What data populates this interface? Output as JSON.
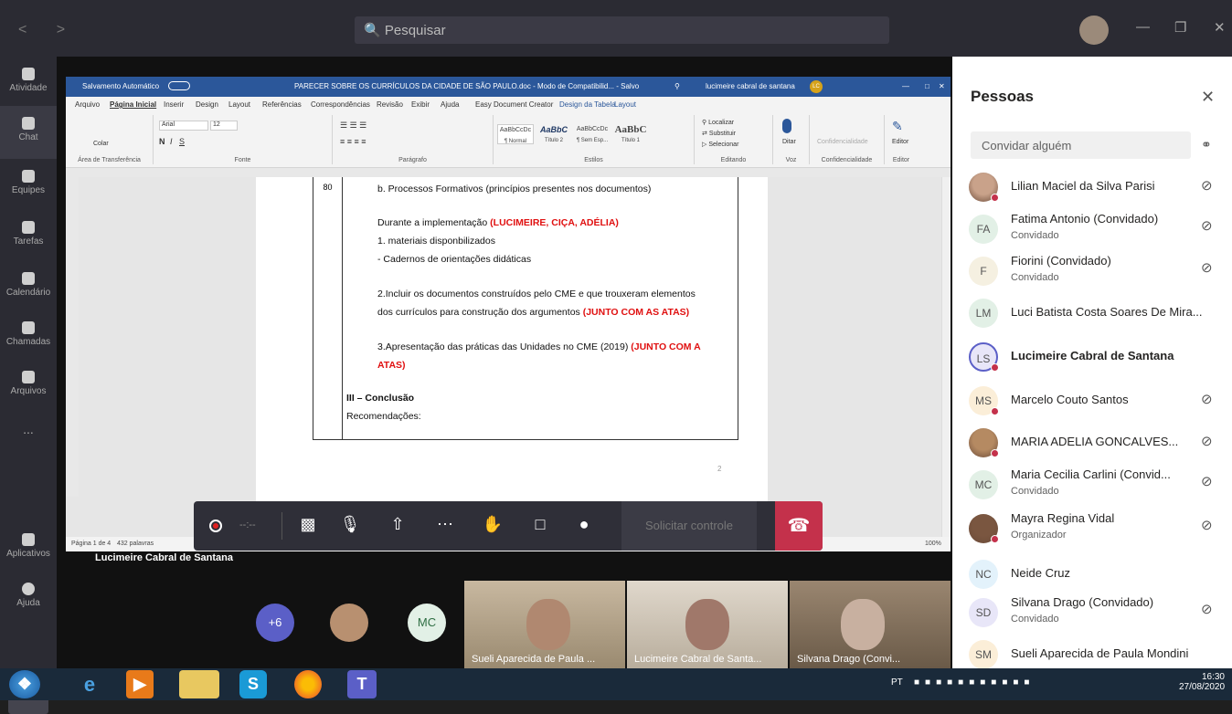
{
  "topbar": {
    "search_placeholder": "Pesquisar"
  },
  "rail": [
    {
      "label": "Atividade",
      "name": "rail-atividade"
    },
    {
      "label": "Chat",
      "name": "rail-chat"
    },
    {
      "label": "Equipes",
      "name": "rail-equipes"
    },
    {
      "label": "Tarefas",
      "name": "rail-tarefas"
    },
    {
      "label": "Calendário",
      "name": "rail-calendario"
    },
    {
      "label": "Chamadas",
      "name": "rail-chamadas"
    },
    {
      "label": "Arquivos",
      "name": "rail-arquivos"
    },
    {
      "label": "...",
      "name": "rail-more"
    },
    {
      "label": "Aplicativos",
      "name": "rail-aplicativos"
    },
    {
      "label": "Ajuda",
      "name": "rail-ajuda"
    }
  ],
  "word": {
    "autosave": "Salvamento Automático",
    "title": "PARECER SOBRE OS CURRÍCULOS DA CIDADE DE SÃO PAULO.doc - Modo de Compatibilid... - Salvo",
    "user": "lucimeire cabral de santana",
    "user_initials": "LC",
    "menu": [
      "Arquivo",
      "Página Inicial",
      "Inserir",
      "Design",
      "Layout",
      "Referências",
      "Correspondências",
      "Revisão",
      "Exibir",
      "Ajuda",
      "Easy Document Creator",
      "Design da Tabela",
      "Layout"
    ],
    "ribbon": {
      "colar": "Colar",
      "clipboard": "Área de Transferência",
      "font_name": "Arial",
      "font_size": "12",
      "fonte": "Fonte",
      "paragrafo": "Parágrafo",
      "styles": [
        {
          "preview": "AaBbCcDc",
          "name": "¶ Normal"
        },
        {
          "preview": "AaBbC",
          "name": "Título 2"
        },
        {
          "preview": "AaBbCcDc",
          "name": "¶ Sem Esp..."
        },
        {
          "preview": "AaBbC",
          "name": "Título 1"
        }
      ],
      "estilos": "Estilos",
      "localizar": "Localizar",
      "substituir": "Substituir",
      "selecionar": "Selecionar",
      "editando": "Editando",
      "ditar": "Ditar",
      "voz": "Voz",
      "confid": "Confidencialidade",
      "editor": "Editor"
    },
    "doc": {
      "row_num": "80",
      "b_line": "b.  Processos Formativos (princípios presentes nos documentos)",
      "impl": "Durante a implementação ",
      "impl_names": "(LUCIMEIRE, CIÇA, ADÉLIA)",
      "item1": "1. materiais disponbilizados",
      "item1b": "- Cadernos de orientações didáticas",
      "item2": "2.Incluir os documentos construídos pelo CME e que trouxeram elementos",
      "item2b": "dos currículos para construção dos argumentos ",
      "item2_red": "(JUNTO COM AS ATAS)",
      "item3": "3.Apresentação das práticas das Unidades no CME (2019) ",
      "item3_red": "(JUNTO COM A",
      "item3_red2": "ATAS)",
      "conclusao": "III – Conclusão",
      "recomend": "Recomendações:",
      "page_num": "2"
    },
    "status": {
      "page": "Página 1 de 4",
      "words": "432 palavras",
      "zoom": "100%"
    }
  },
  "call": {
    "timer": "--:--",
    "request_control": "Solicitar controle",
    "presenter": "Lucimeire Cabral de Santana",
    "overflow": "+6",
    "mc": "MC",
    "tiles": [
      {
        "name": "Sueli Aparecida de Paula ..."
      },
      {
        "name": "Lucimeire Cabral de Santa..."
      },
      {
        "name": "Silvana Drago (Convi..."
      }
    ]
  },
  "people": {
    "title": "Pessoas",
    "invite_placeholder": "Convidar alguém",
    "list": [
      {
        "name": "Lilian Maciel da Silva Parisi",
        "sub": "",
        "initials": "",
        "photo": true,
        "color": "#c9a28a",
        "muted": true,
        "dot": true
      },
      {
        "name": "Fatima Antonio (Convidado)",
        "sub": "Convidado",
        "initials": "FA",
        "photo": false,
        "color": "#e2f0e6",
        "muted": true,
        "dot": false
      },
      {
        "name": "Fiorini (Convidado)",
        "sub": "Convidado",
        "initials": "F",
        "photo": false,
        "color": "#f5f0e1",
        "muted": true,
        "dot": false
      },
      {
        "name": "Luci Batista Costa Soares De Mira...",
        "sub": "",
        "initials": "LM",
        "photo": false,
        "color": "#e2f0e6",
        "muted": false,
        "dot": false
      },
      {
        "name": "Lucimeire Cabral de Santana",
        "sub": "",
        "initials": "LS",
        "photo": false,
        "color": "#e8e6f8",
        "muted": false,
        "dot": true,
        "bold": true
      },
      {
        "name": "Marcelo Couto Santos",
        "sub": "",
        "initials": "MS",
        "photo": false,
        "color": "#fbeed8",
        "muted": true,
        "dot": true
      },
      {
        "name": "MARIA ADELIA GONCALVES...",
        "sub": "",
        "initials": "",
        "photo": true,
        "color": "#b58a62",
        "muted": true,
        "dot": true
      },
      {
        "name": "Maria Cecilia Carlini (Convid...",
        "sub": "Convidado",
        "initials": "MC",
        "photo": false,
        "color": "#e2f0e6",
        "muted": true,
        "dot": false
      },
      {
        "name": "Mayra Regina Vidal",
        "sub": "Organizador",
        "initials": "",
        "photo": true,
        "color": "#7a5640",
        "muted": true,
        "dot": true
      },
      {
        "name": "Neide Cruz",
        "sub": "",
        "initials": "NC",
        "photo": false,
        "color": "#e3f2fb",
        "muted": false,
        "dot": false
      },
      {
        "name": "Silvana Drago (Convidado)",
        "sub": "Convidado",
        "initials": "SD",
        "photo": false,
        "color": "#e8e6f8",
        "muted": true,
        "dot": false
      },
      {
        "name": "Sueli Aparecida de Paula Mondini",
        "sub": "",
        "initials": "SM",
        "photo": false,
        "color": "#fbeed8",
        "muted": false,
        "dot": false
      }
    ]
  },
  "taskbar": {
    "lang": "PT",
    "time": "16:30",
    "date": "27/08/2020"
  },
  "colors": {
    "teams_dark": "#2b2b33",
    "word_blue": "#2b579a",
    "hangup": "#c4314b",
    "red_text": "#e01010"
  }
}
